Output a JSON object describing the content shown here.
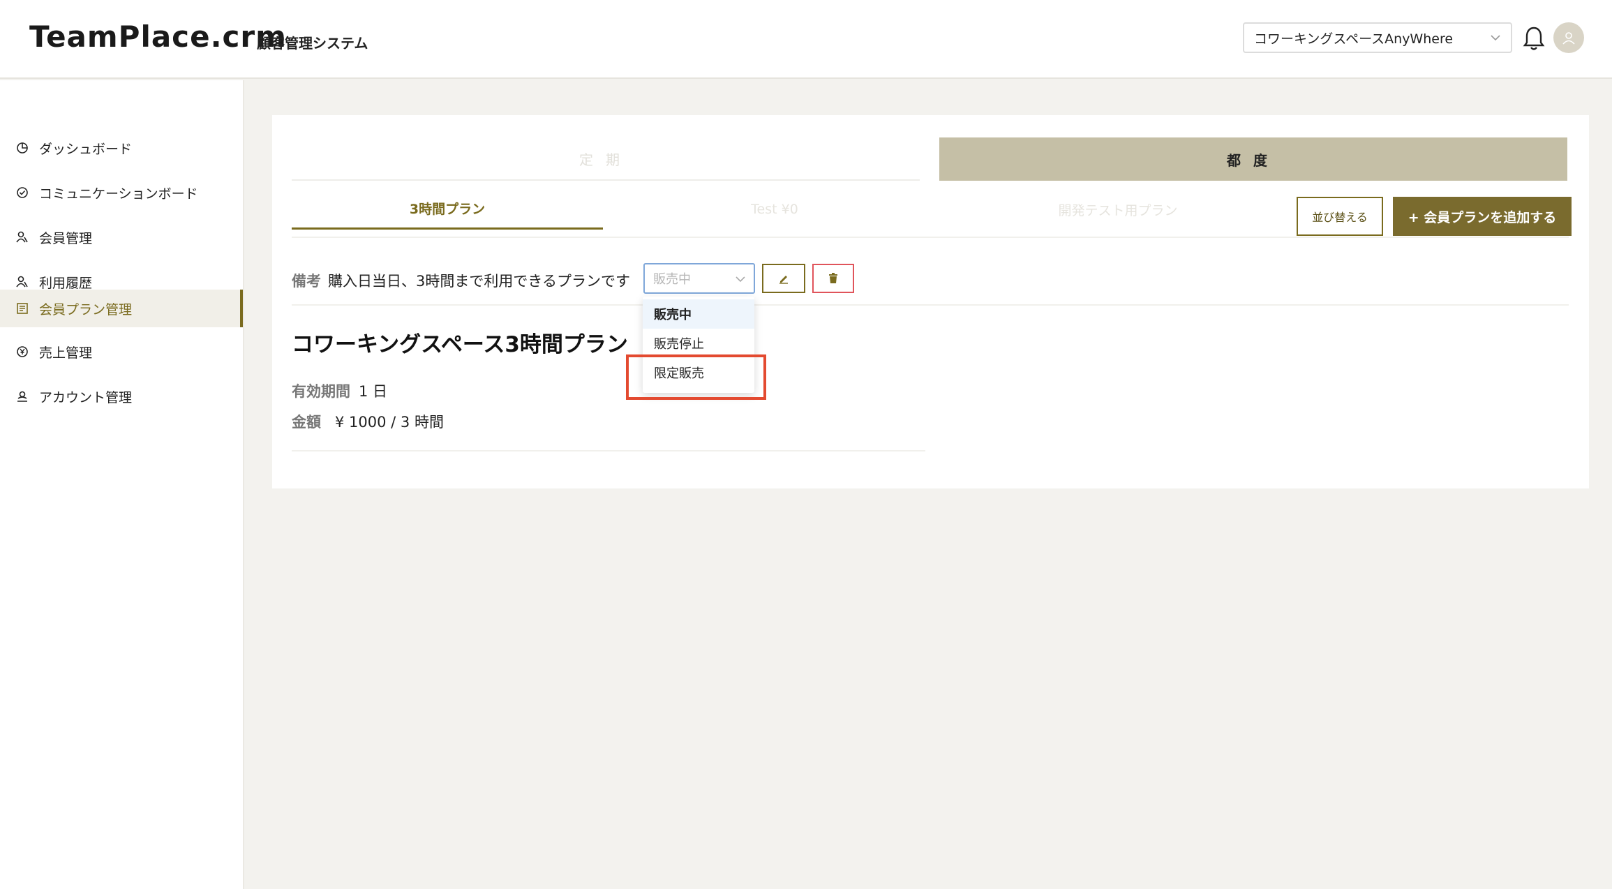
{
  "header": {
    "logo_text": "TeamPlace.crm",
    "subtitle": "顧客管理システム",
    "space_selector_value": "コワーキングスペースAnyWhere"
  },
  "sidebar": {
    "items": [
      {
        "label": "ダッシュボード",
        "icon": "pie-chart-icon"
      },
      {
        "label": "コミュニケーションボード",
        "icon": "check-circle-icon"
      },
      {
        "label": "会員管理",
        "icon": "users-icon"
      },
      {
        "label": "利用履歴",
        "icon": "users-icon"
      },
      {
        "label": "会員プラン管理",
        "icon": "list-icon",
        "active": true
      },
      {
        "label": "売上管理",
        "icon": "yen-circle-icon"
      },
      {
        "label": "アカウント管理",
        "icon": "account-icon"
      }
    ]
  },
  "segments": {
    "left_label": "定期",
    "right_label": "都度"
  },
  "plan_tabs": [
    {
      "label": "3時間プラン",
      "active": true
    },
    {
      "label": "Test ¥0"
    },
    {
      "label": "開発テスト用プラン"
    }
  ],
  "buttons": {
    "sort_label": "並び替える",
    "add_label": "+ 会員プランを追加する"
  },
  "plan": {
    "note_label": "備考",
    "note_text": "購入日当日、3時間まで利用できるプランです",
    "status_value": "販売中",
    "title": "コワーキングスペース3時間プラン",
    "validity_label": "有効期間",
    "validity_value": "1 日",
    "price_label": "金額",
    "price_value": "¥ 1000 / 3 時間"
  },
  "status_dropdown": {
    "options": [
      "販売中",
      "販売停止",
      "限定販売"
    ],
    "selected": "販売中"
  },
  "colors": {
    "accent": "#7a6b1e",
    "segment_active": "#c5bfa6",
    "highlight": "#e34a30",
    "danger": "#e0545b"
  }
}
